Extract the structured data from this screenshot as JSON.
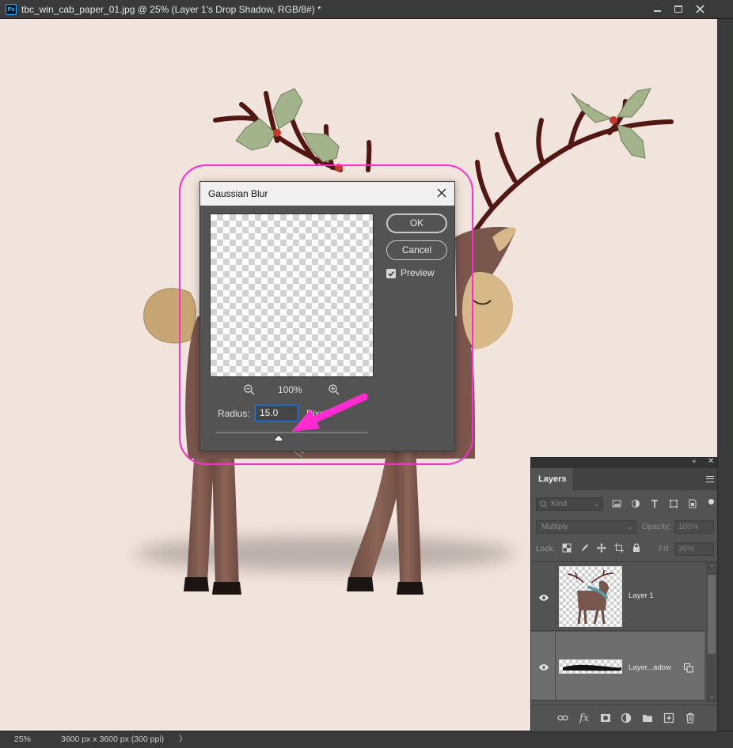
{
  "app": {
    "app_icon_text": "Ps",
    "document_title": "tbc_win_cab_paper_01.jpg @ 25% (Layer 1's Drop Shadow, RGB/8#) *",
    "window_controls": [
      "minimize-icon",
      "maximize-icon",
      "close-icon"
    ]
  },
  "status_bar": {
    "zoom": "25%",
    "doc_info": "3600 px x 3600 px (300 ppi)",
    "more_arrow": "〉"
  },
  "dialog": {
    "title": "Gaussian Blur",
    "ok_label": "OK",
    "cancel_label": "Cancel",
    "preview_label": "Preview",
    "preview_checked": true,
    "zoom_percent": "100%",
    "radius_label": "Radius:",
    "radius_value": "15.0",
    "radius_unit": "Pixels",
    "highlight_color": "#ff2ad0",
    "annotation_arrow_color": "#ff2ad0"
  },
  "layers_panel": {
    "collapse_glyph": "«",
    "close_glyph": "✕",
    "tab_label": "Layers",
    "filter_kind": "Kind",
    "blend_mode": "Multiply",
    "opacity_label": "Opacity:",
    "opacity_value": "100%",
    "lock_label": "Lock:",
    "fill_label": "Fill:",
    "fill_value": "36%",
    "layers": [
      {
        "name": "Layer 1",
        "visible": true,
        "selected": false
      },
      {
        "name": "Layer...adow",
        "visible": true,
        "selected": true
      }
    ],
    "footer_icons": [
      "link-layers-icon",
      "fx-icon",
      "add-mask-icon",
      "adjustment-layer-icon",
      "new-group-icon",
      "new-layer-icon",
      "delete-layer-icon"
    ],
    "footer_fx_text": "fx"
  },
  "colors": {
    "canvas_bg": "#f1e4dc",
    "panel_bg": "#535353",
    "accent_blue": "#2f7dd8"
  }
}
